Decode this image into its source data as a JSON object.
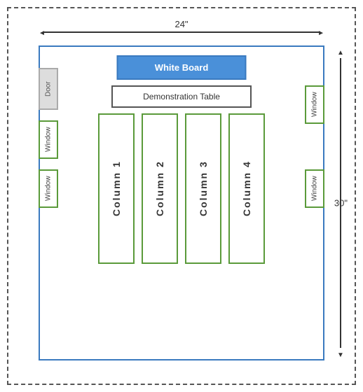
{
  "dimensions": {
    "width_label": "24\"",
    "height_label": "30\""
  },
  "whiteboard": {
    "label": "White Board"
  },
  "demo_table": {
    "label": "Demonstration Table"
  },
  "columns": [
    {
      "label": "Column 1"
    },
    {
      "label": "Column 2"
    },
    {
      "label": "Column 3"
    },
    {
      "label": "Column 4"
    }
  ],
  "door": {
    "label": "Door"
  },
  "windows": [
    {
      "label": "Window"
    },
    {
      "label": "Window"
    },
    {
      "label": "Window"
    },
    {
      "label": "Window"
    }
  ]
}
